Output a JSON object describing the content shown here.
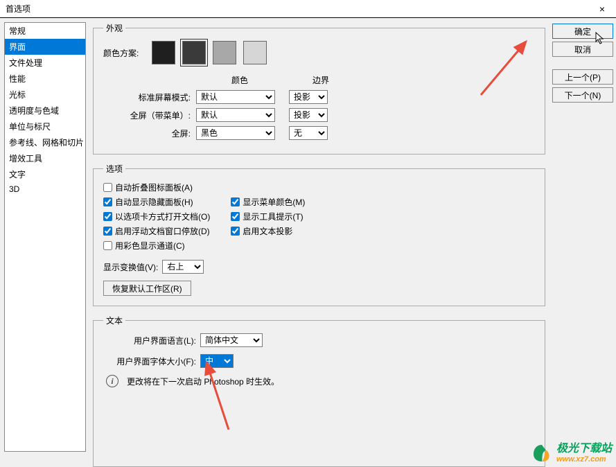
{
  "titlebar": {
    "title": "首选项",
    "close": "×"
  },
  "sidebar": {
    "items": [
      {
        "label": "常规"
      },
      {
        "label": "界面"
      },
      {
        "label": "文件处理"
      },
      {
        "label": "性能"
      },
      {
        "label": "光标"
      },
      {
        "label": "透明度与色域"
      },
      {
        "label": "单位与标尺"
      },
      {
        "label": "参考线、网格和切片"
      },
      {
        "label": "增效工具"
      },
      {
        "label": "文字"
      },
      {
        "label": "3D"
      }
    ],
    "selectedIndex": 1
  },
  "actions": {
    "ok": "确定",
    "cancel": "取消",
    "prev": "上一个(P)",
    "next": "下一个(N)"
  },
  "appearance": {
    "legend": "外观",
    "color_scheme_label": "颜色方案:",
    "swatches": [
      "#1f1f1f",
      "#3a3a3a",
      "#a8a8a8",
      "#d6d6d6"
    ],
    "swatch_selected": 1,
    "col_color": "颜色",
    "col_border": "边界",
    "rows": [
      {
        "label": "标准屏幕模式:",
        "color": "默认",
        "border": "投影"
      },
      {
        "label": "全屏（带菜单）:",
        "color": "默认",
        "border": "投影"
      },
      {
        "label": "全屏:",
        "color": "黑色",
        "border": "无"
      }
    ]
  },
  "options": {
    "legend": "选项",
    "left": [
      {
        "label": "自动折叠图标面板(A)",
        "checked": false
      },
      {
        "label": "自动显示隐藏面板(H)",
        "checked": true
      },
      {
        "label": "以选项卡方式打开文档(O)",
        "checked": true
      },
      {
        "label": "启用浮动文档窗口停放(D)",
        "checked": true
      },
      {
        "label": "用彩色显示通道(C)",
        "checked": false
      }
    ],
    "right": [
      {
        "label": "显示菜单颜色(M)",
        "checked": true
      },
      {
        "label": "显示工具提示(T)",
        "checked": true
      },
      {
        "label": "启用文本投影",
        "checked": true
      }
    ],
    "transform_label": "显示变换值(V):",
    "transform_value": "右上",
    "reset_button": "恢复默认工作区(R)"
  },
  "text": {
    "legend": "文本",
    "lang_label": "用户界面语言(L):",
    "lang_value": "简体中文",
    "font_label": "用户界面字体大小(F):",
    "font_value": "中",
    "info_msg": "更改将在下一次启动 Photoshop 时生效。"
  },
  "watermark": {
    "zh": "极光下载站",
    "en": "www.xz7.com"
  }
}
